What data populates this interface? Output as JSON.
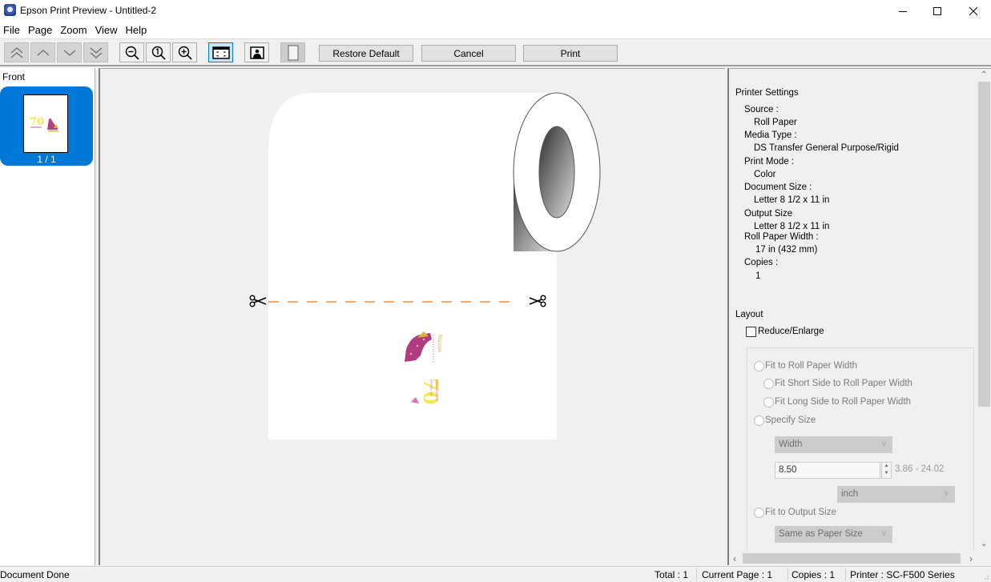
{
  "window": {
    "title": "Epson Print Preview - Untitled-2",
    "controls": [
      "minimize",
      "maximize",
      "close"
    ]
  },
  "menubar": [
    "File",
    "Page",
    "Zoom",
    "View",
    "Help"
  ],
  "toolbar": {
    "nav_buttons": [
      "first-page",
      "previous-page",
      "next-page",
      "last-page"
    ],
    "zoom_buttons": [
      "zoom-out",
      "actual-size",
      "zoom-in"
    ],
    "view_buttons": [
      "fit-to-window",
      "show-image",
      "show-paper"
    ],
    "restore_default_label": "Restore Default",
    "cancel_label": "Cancel",
    "print_label": "Print"
  },
  "thumbnails": {
    "section_label": "Front",
    "pages": [
      {
        "label": "1 / 1",
        "selected": true
      }
    ]
  },
  "preview": {
    "media": "roll-paper",
    "cut_line_color": "#e87a1e",
    "images": [
      "high-heel-shoe-maxine",
      "70-years-of-excellence"
    ]
  },
  "printer_settings": {
    "heading": "Printer Settings",
    "items": [
      {
        "label": "Source :",
        "value": "Roll Paper"
      },
      {
        "label": "Media Type :",
        "value": "DS Transfer General Purpose/Rigid"
      },
      {
        "label": "Print Mode :",
        "value": "Color"
      },
      {
        "label": "Document Size :",
        "value": "Letter 8 1/2 x 11 in"
      },
      {
        "label": "Output Size",
        "value": "Letter 8 1/2 x 11 in"
      },
      {
        "label": "Roll Paper Width :",
        "value": "17 in (432 mm)"
      },
      {
        "label": "Copies :",
        "value": "1"
      }
    ]
  },
  "layout": {
    "heading": "Layout",
    "reduce_enlarge_label": "Reduce/Enlarge",
    "reduce_enlarge_checked": false,
    "options": {
      "fit_roll": "Fit to Roll Paper Width",
      "fit_short": "Fit Short Side to Roll Paper Width",
      "fit_long": "Fit Long Side to Roll Paper Width",
      "specify_size": "Specify Size",
      "fit_output": "Fit to Output Size"
    },
    "dimension_select": "Width",
    "size_value": "8.50",
    "size_range": "3.86 - 24.02",
    "unit_select": "inch",
    "output_select": "Same as Paper Size"
  },
  "statusbar": {
    "message": "Document Done",
    "total": "Total : 1",
    "current_page": "Current Page : 1",
    "copies": "Copies : 1",
    "printer": "Printer : SC-F500 Series"
  }
}
